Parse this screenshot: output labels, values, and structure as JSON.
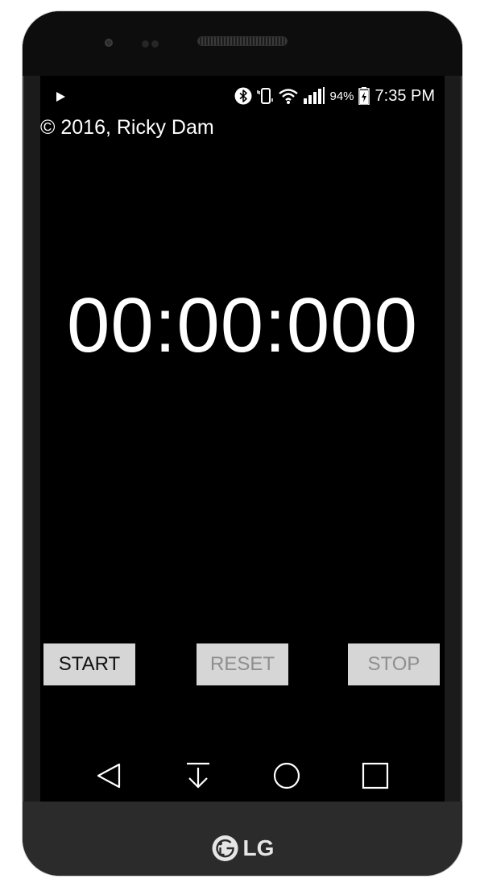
{
  "status_bar": {
    "battery_percent": "94%",
    "time": "7:35 PM",
    "icons": [
      "play-icon",
      "bluetooth-icon",
      "vibrate-icon",
      "wifi-icon",
      "signal-icon",
      "battery-charging-icon"
    ]
  },
  "copyright": "© 2016, Ricky Dam",
  "timer": {
    "display": "00:00:000"
  },
  "buttons": {
    "start": "START",
    "reset": "RESET",
    "stop": "STOP"
  },
  "navbar": {
    "icons": [
      "back-icon",
      "notification-pull-icon",
      "home-icon",
      "recents-icon"
    ]
  },
  "device": {
    "brand": "LG"
  },
  "colors": {
    "screen_bg": "#000000",
    "button_bg": "#d6d6d6",
    "button_disabled_text": "#8f8f8f",
    "text": "#ffffff"
  }
}
